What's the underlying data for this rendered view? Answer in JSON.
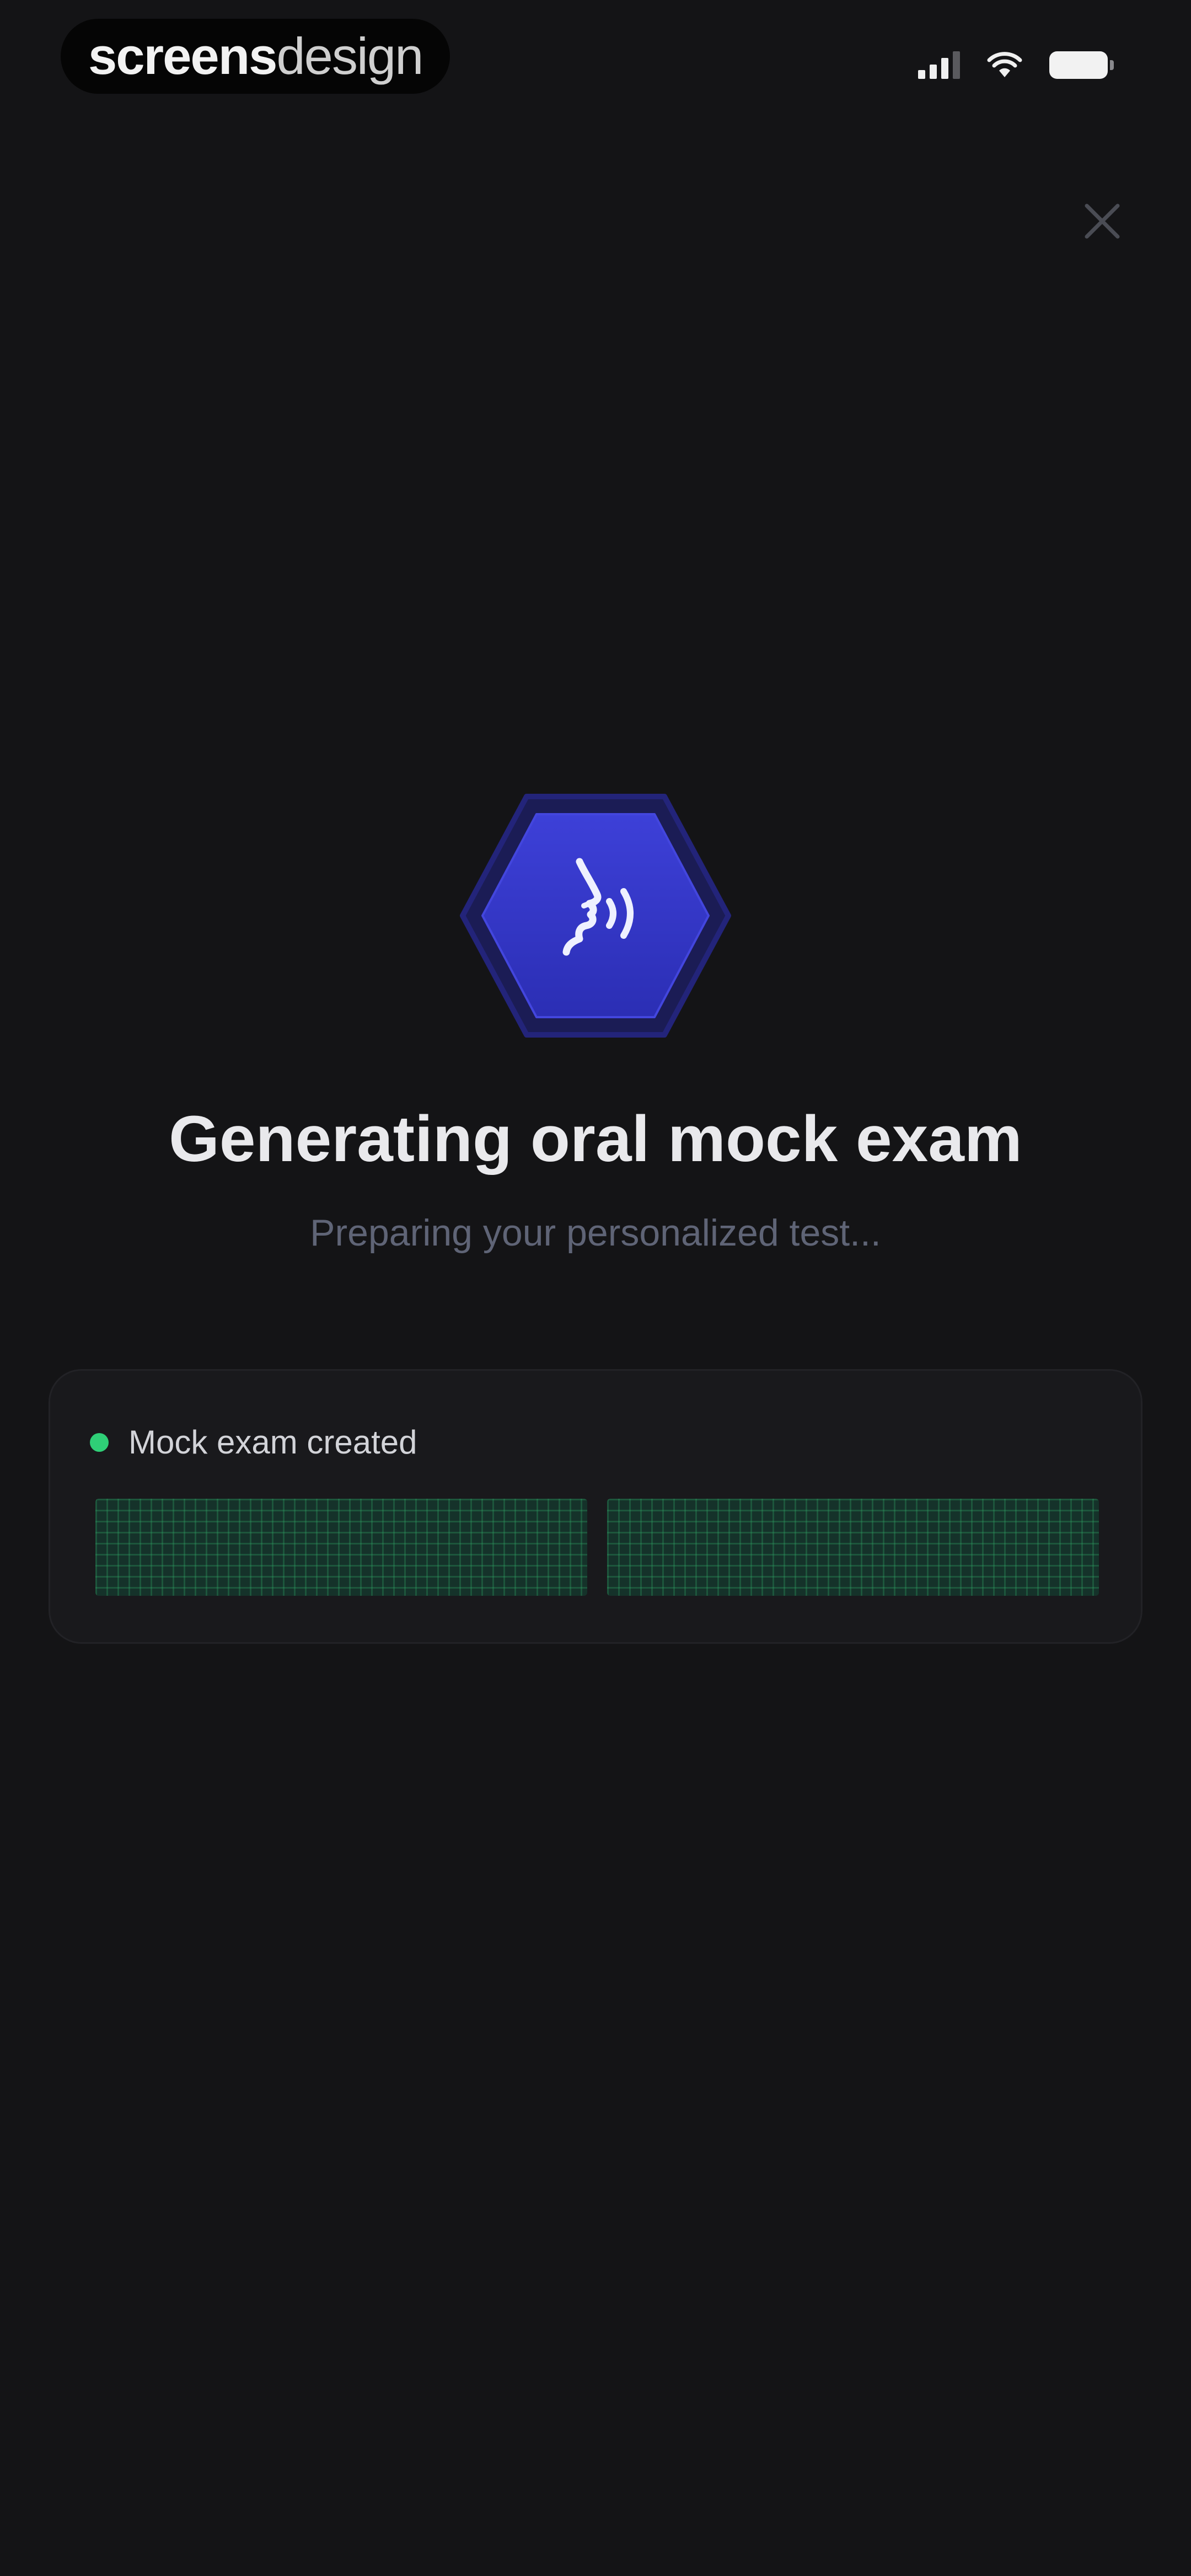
{
  "watermark": {
    "bold": "screens",
    "light": "design"
  },
  "status_bar": {
    "icons": [
      "signal-icon",
      "wifi-icon",
      "battery-icon"
    ]
  },
  "close_icon": "close-icon",
  "hero": {
    "badge_icon": "speaking-head-icon",
    "title": "Generating oral mock exam",
    "subtitle": "Preparing your personalized test..."
  },
  "progress": {
    "steps": [
      {
        "label": "Mock exam created",
        "status": "done"
      }
    ],
    "segments": [
      {
        "fill": 1.0
      },
      {
        "fill": 1.0
      }
    ]
  },
  "colors": {
    "background": "#141416",
    "card": "#19191c",
    "badge_fill": "#3538c9",
    "badge_ring": "#23247a",
    "success": "#2fcf77",
    "segment": "#15322a",
    "subtitle": "#5f6476"
  }
}
